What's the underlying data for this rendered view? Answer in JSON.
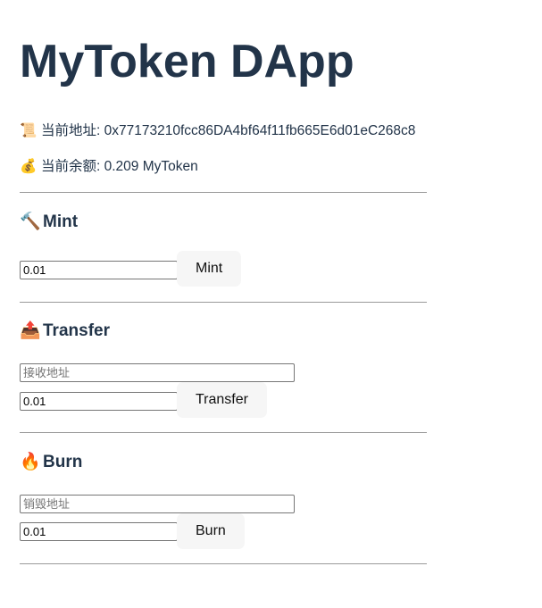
{
  "app": {
    "title": "MyToken DApp"
  },
  "account": {
    "address_icon": "scroll-icon",
    "address_icon_glyph": "📜",
    "address_label": "当前地址: 0x77173210fcc86DA4bf64f11fb665E6d01eC268c8",
    "balance_icon": "money-bag-icon",
    "balance_icon_glyph": "💰",
    "balance_label": "当前余额: 0.209 MyToken"
  },
  "mint": {
    "icon": "hammer-icon",
    "icon_glyph": "🔨",
    "title": "Mint",
    "amount_value": "0.01",
    "button_label": "Mint"
  },
  "transfer": {
    "icon": "outbox-tray-icon",
    "icon_glyph": "📤",
    "title": "Transfer",
    "recipient_placeholder": "接收地址",
    "amount_value": "0.01",
    "button_label": "Transfer"
  },
  "burn": {
    "icon": "fire-icon",
    "icon_glyph": "🔥",
    "title": "Burn",
    "address_placeholder": "销毁地址",
    "amount_value": "0.01",
    "button_label": "Burn"
  },
  "colors": {
    "heading": "#223449",
    "button_bg": "#f6f6f6",
    "divider": "#9a9a9a"
  }
}
